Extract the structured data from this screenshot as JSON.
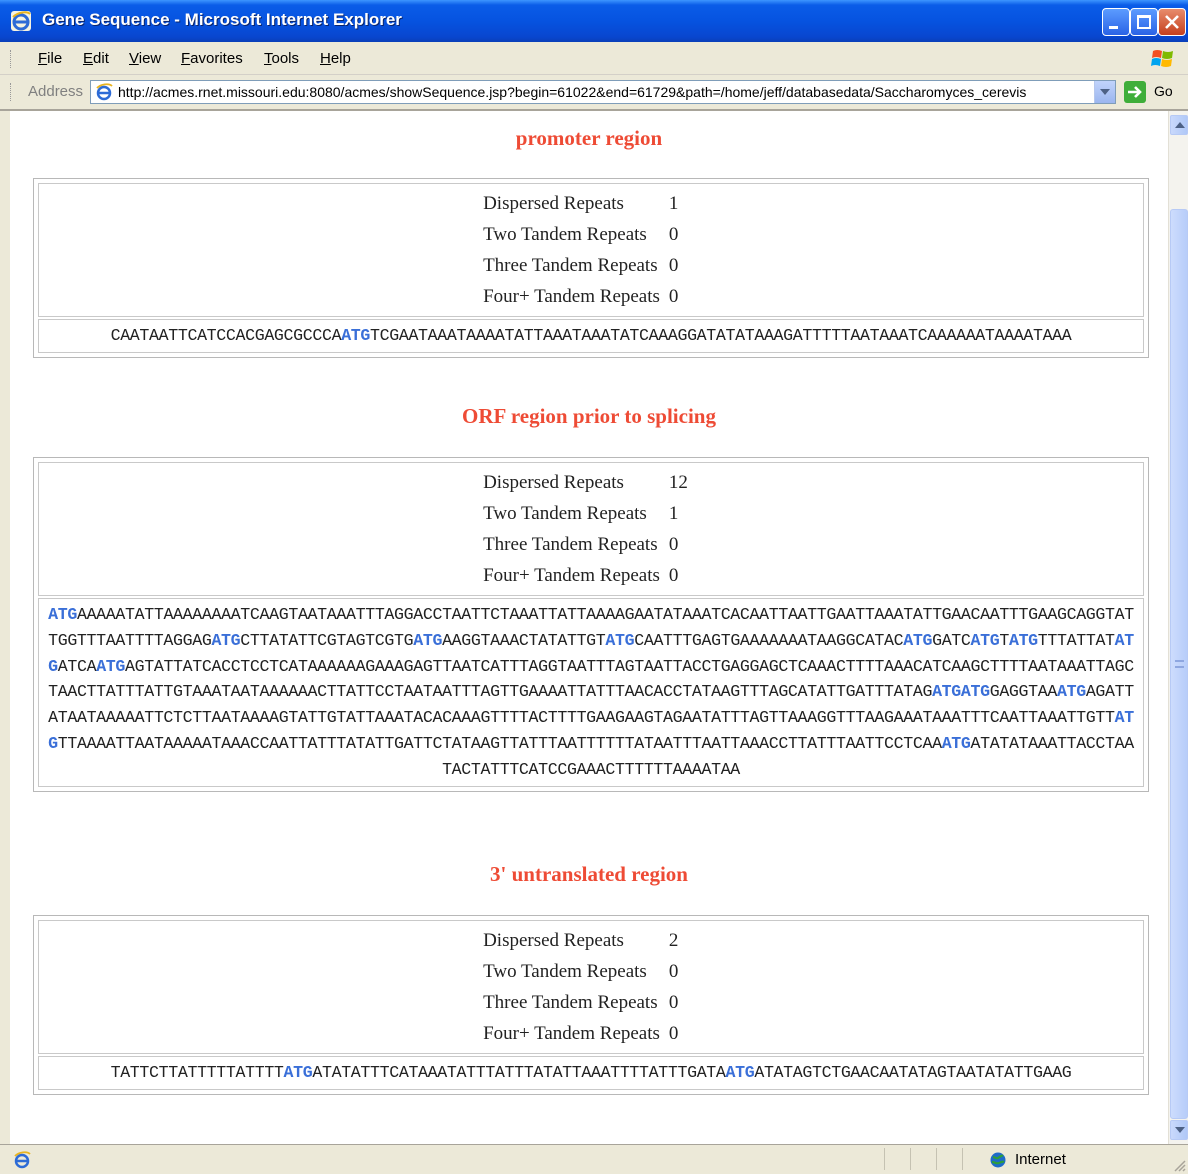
{
  "window": {
    "title": "Gene Sequence - Microsoft Internet Explorer"
  },
  "menu": {
    "items": [
      "File",
      "Edit",
      "View",
      "Favorites",
      "Tools",
      "Help"
    ]
  },
  "address": {
    "label": "Address",
    "url": "http://acmes.rnet.missouri.edu:8080/acmes/showSequence.jsp?begin=61022&end=61729&path=/home/jeff/databasedata/Saccharomyces_cerevis",
    "go_label": "Go"
  },
  "stat_labels": [
    "Dispersed Repeats",
    "Two Tandem Repeats",
    "Three Tandem Repeats",
    "Four+ Tandem Repeats"
  ],
  "regions": [
    {
      "title": "promoter region",
      "stats": [
        "1",
        "0",
        "0",
        "0"
      ],
      "sequence": "CAATAATTCATCCACGAGCGCCCAATGTCGAATAAATAAAATATTAAATAAATATCAAAGGATATATAAAGATTTTTAATAAATCAAAAAATAAAATAAA"
    },
    {
      "title": "ORF region prior to splicing",
      "stats": [
        "12",
        "1",
        "0",
        "0"
      ],
      "sequence": "ATGAAAAATATTAAAAAAAATCAAGTAATAAATTTAGGACCTAATTCTAAATTATTAAAAGAATATAAATCACAATTAATTGAATTAAATATTGAACAATTTGAAGCAGGTATTGGTTTAATTTTAGGAGATGCTTATATTCGTAGTCGTGATGAAGGTAAACTATATTGTATGCAATTTGAGTGAAAAAAATAAGGCATACATGGATCATGTATGTTTATTATATGATCAATGAGTATTATCACCTCCTCATAAAAAAGAAAGAGTTAATCATTTAGGTAATTTAGTAATTACCTGAGGAGCTCAAACTTTTAAACATCAAGCTTTTAATAAATTAGCTAACTTATTTATTGTAAATAATAAAAAACTTATTCCTAATAATTTAGTTGAAAATTATTTAACACCTATAAGTTTAGCATATTGATTTATAGATGATGGAGGTAAATGAGATTATAATAAAAATTCTCTTAATAAAAGTATTGTATTAAATACACAAAGTTTTACTTTTGAAGAAGTAGAATATTTAGTTAAAGGTTTAAGAAATAAATTTCAATTAAATTGTTATGTTAAAATTAATAAAAATAAACCAATTATTTATATTGATTCTATAAGTTATTTAATTTTTTATAATTTAATTAAACCTTATTTAATTCCTCAAATGATATATAAATTACCTAATACTATTTCATCCGAAACTTTTTTAAAATAA"
    },
    {
      "title": "3' untranslated region",
      "stats": [
        "2",
        "0",
        "0",
        "0"
      ],
      "sequence": "TATTCTTATTTTTATTTTATGATATATTTCATAAATATTTATTTATATTAAATTTTATTTGATAATGATATAGTCTGAACAATATAGTAATATATTGAAG"
    }
  ],
  "status": {
    "zone": "Internet"
  }
}
